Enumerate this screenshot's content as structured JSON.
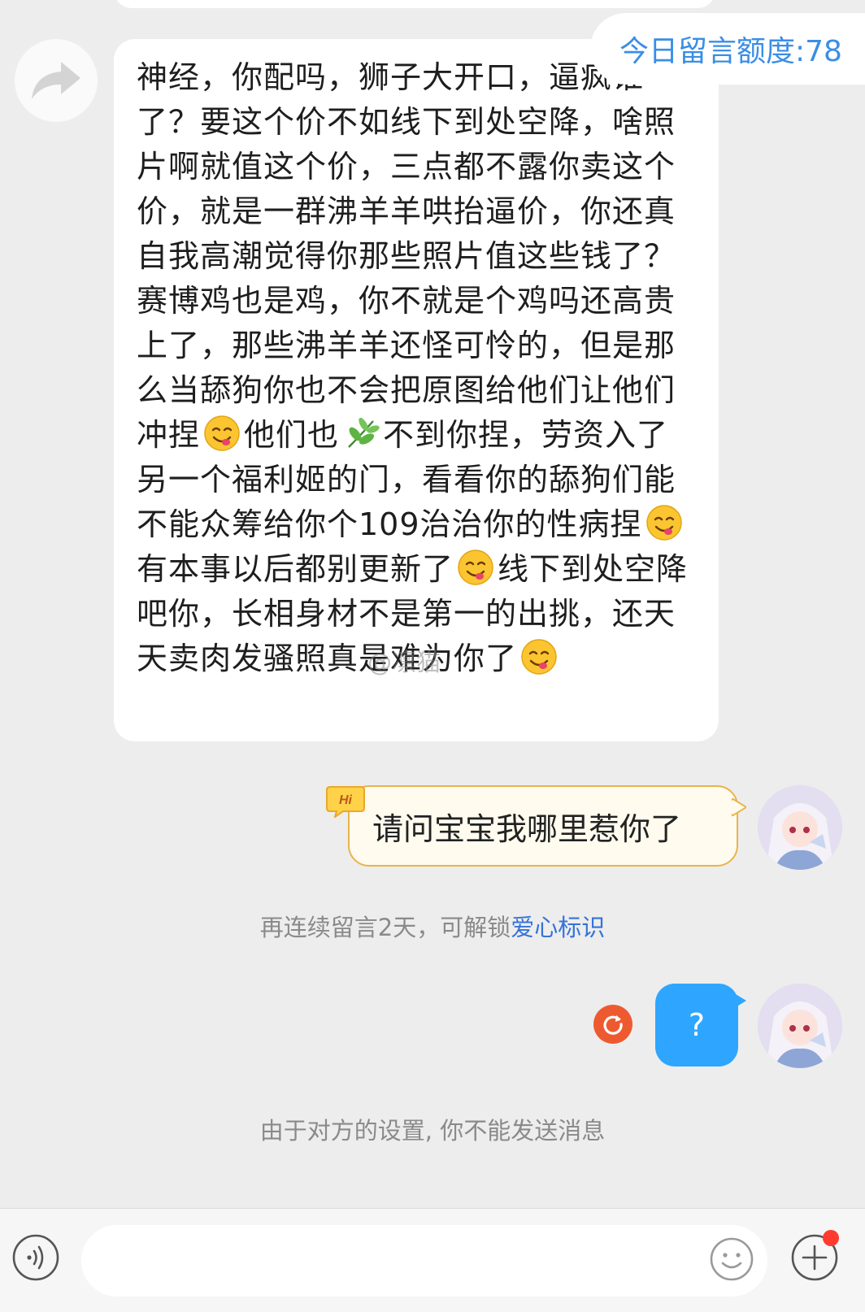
{
  "quota": {
    "label": "今日留言额度:78"
  },
  "incoming_message": {
    "segments": [
      {
        "text": "神经，你配吗，狮子大开口，逼疯谁了？要这个价不如线下到处空降，啥照片啊就值这个价，三点都不露你卖这个价，就是一群沸羊羊哄抬逼价，你还真自我高潮觉得你那些照片值这些钱了？赛博鸡也是鸡，你不就是个鸡吗还高贵上了，那些沸羊羊还怪可怜的，但是那么当舔狗你也不会把原图给他们让他们冲捏"
      },
      {
        "emoji": "yum-emoji"
      },
      {
        "text": "他们也"
      },
      {
        "emoji": "herb-emoji"
      },
      {
        "text": "不到你捏，劳资入了另一个福利姬的门，看看你的舔狗们能不能众筹给你个109治治你的性病捏"
      },
      {
        "emoji": "yum-emoji"
      },
      {
        "text": "有本事以后都别更新了"
      },
      {
        "emoji": "yum-emoji"
      },
      {
        "text": "线下到处空降吧你，长相身材不是第一的出挑，还天天卖肉发骚照真是难为你了"
      },
      {
        "emoji": "yum-emoji"
      }
    ]
  },
  "watermark": "@凛猫",
  "outgoing_hi_message": {
    "badge": "Hi",
    "text": "请问宝宝我哪里惹你了"
  },
  "streak_notice": {
    "text": "再连续留言2天，可解锁",
    "link": "爱心标识"
  },
  "outgoing_question": {
    "text": "?"
  },
  "blocked_notice": "由于对方的设置, 你不能发送消息",
  "input": {
    "placeholder": ""
  },
  "colors": {
    "background": "#ededed",
    "accent_blue": "#2ea6ff",
    "link_blue": "#3573d9",
    "retry_red": "#ee5a30",
    "hi_border": "#e9b44a"
  },
  "icons": [
    "forward-icon",
    "retry-icon",
    "voice-icon",
    "emoji-face-icon",
    "plus-icon"
  ]
}
